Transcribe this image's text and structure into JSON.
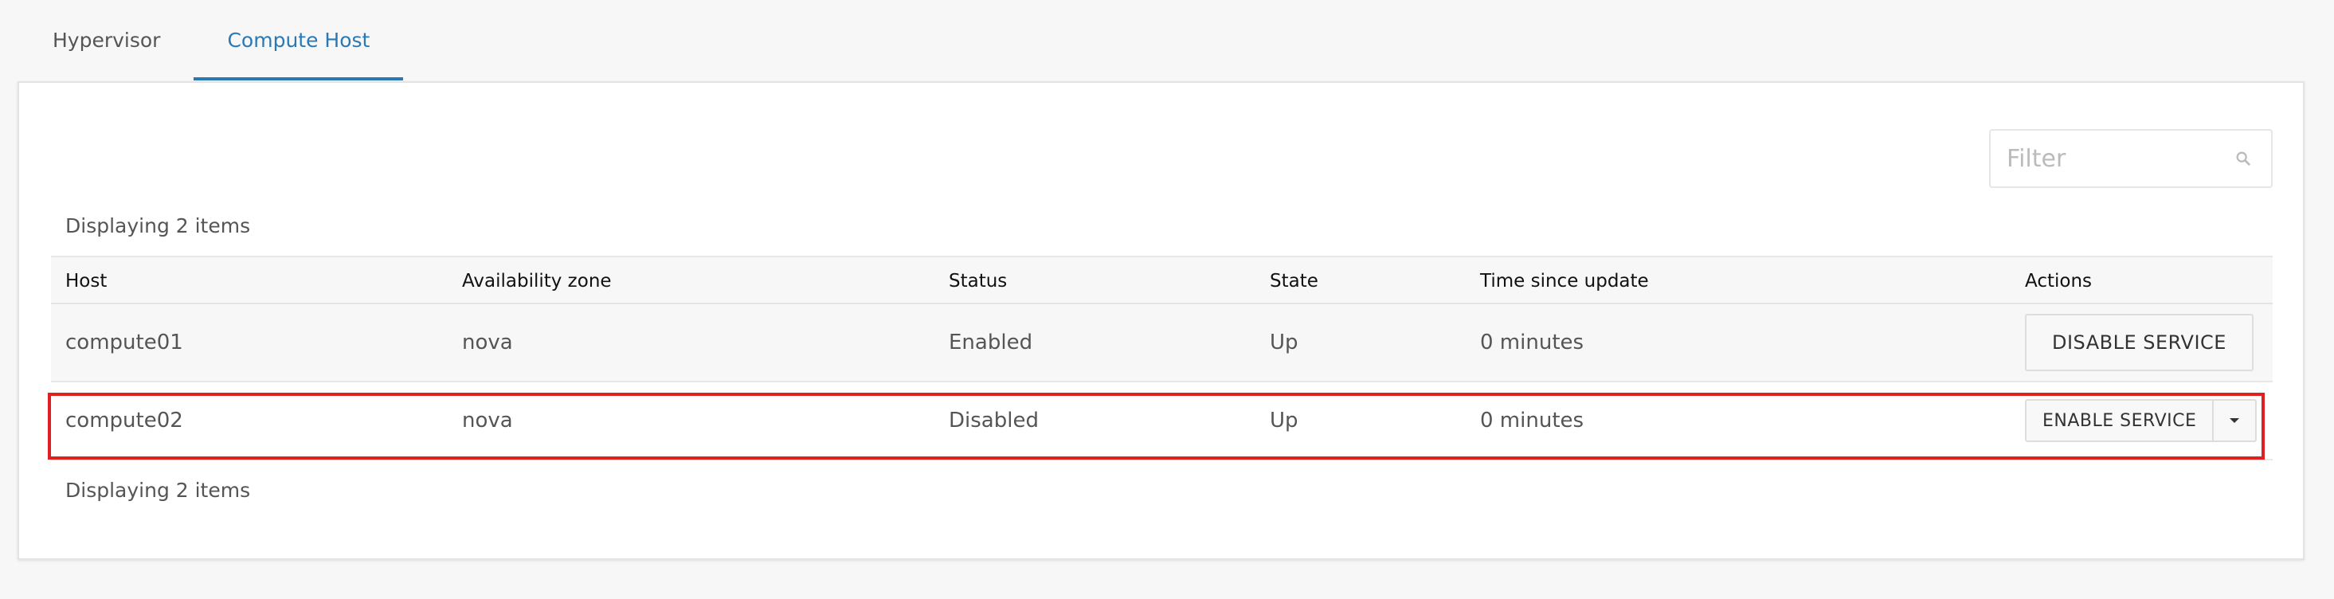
{
  "tabs": [
    {
      "label": "Hypervisor",
      "active": false
    },
    {
      "label": "Compute Host",
      "active": true
    }
  ],
  "filter": {
    "placeholder": "Filter"
  },
  "count_text": "Displaying 2 items",
  "table": {
    "columns": [
      "Host",
      "Availability zone",
      "Status",
      "State",
      "Time since update",
      "Actions"
    ],
    "rows": [
      {
        "host": "compute01",
        "zone": "nova",
        "status": "Enabled",
        "state": "Up",
        "time": "0 minutes",
        "action": "DISABLE SERVICE"
      },
      {
        "host": "compute02",
        "zone": "nova",
        "status": "Disabled",
        "state": "Up",
        "time": "0 minutes",
        "action": "ENABLE SERVICE"
      }
    ]
  },
  "colors": {
    "accent": "#2a79b4",
    "highlight": "#e02020"
  },
  "icons": {
    "search": "search-icon",
    "caret": "caret-down-icon"
  }
}
